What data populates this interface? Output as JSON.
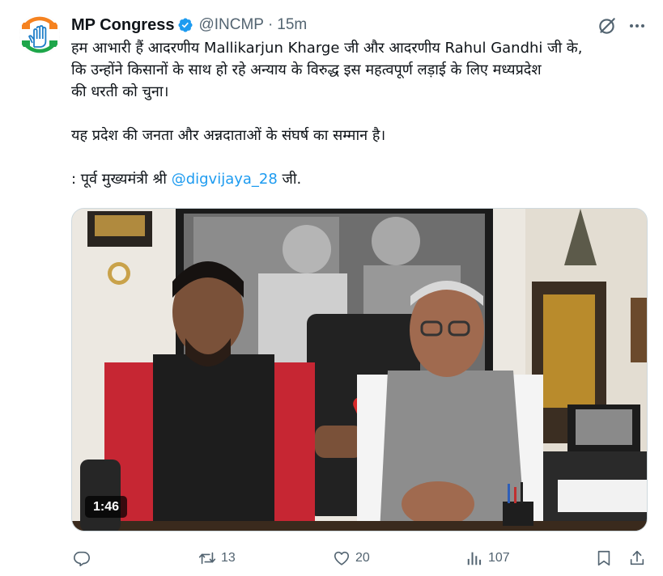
{
  "tweet": {
    "author_name": "MP Congress",
    "handle": "@INCMP",
    "separator": "·",
    "time": "15m",
    "text_lines": [
      "हम आभारी हैं आदरणीय Mallikarjun Kharge जी और आदरणीय Rahul Gandhi जी के,",
      "कि उन्होंने किसानों के साथ हो रहे अन्याय के विरुद्ध इस महत्वपूर्ण लड़ाई के लिए मध्यप्रदेश",
      "की धरती को चुना।",
      "यह प्रदेश की जनता और अन्नदाताओं के संघर्ष का सम्मान है।"
    ],
    "quote_prefix": ": पूर्व मुख्यमंत्री श्री ",
    "mention": "@digvijaya_28",
    "quote_suffix": " जी."
  },
  "media": {
    "duration": "1:46"
  },
  "actions": {
    "replies": "",
    "reposts": "13",
    "likes": "20",
    "views": "107"
  },
  "icons": {
    "verified": "verified-badge-icon",
    "grok": "grok-icon",
    "more": "more-icon",
    "reply": "reply-icon",
    "repost": "repost-icon",
    "like": "heart-icon",
    "views": "views-icon",
    "bookmark": "bookmark-icon",
    "share": "share-icon"
  },
  "colors": {
    "text": "#0f1419",
    "secondary": "#536471",
    "link": "#1d9bf0",
    "verified": "#1d9bf0"
  }
}
